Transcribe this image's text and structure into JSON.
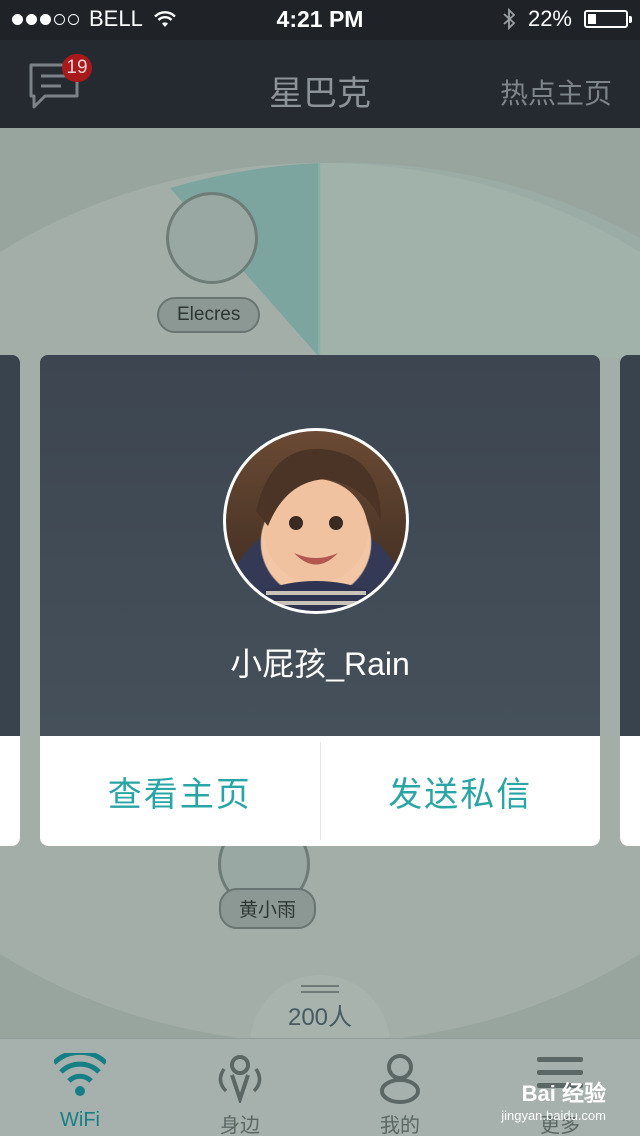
{
  "status_bar": {
    "carrier": "BELL",
    "time": "4:21 PM",
    "battery": "22%",
    "battery_level": 0.22,
    "signal_bars": 3
  },
  "nav": {
    "title": "星巴克",
    "right_link": "热点主页",
    "message_badge": "19"
  },
  "peers": [
    {
      "name": "Elecres"
    },
    {
      "name": "黄小雨"
    }
  ],
  "card": {
    "user_name": "小屁孩_Rain",
    "view_profile": "查看主页",
    "send_message": "发送私信"
  },
  "people_count": "200人",
  "tabs": [
    {
      "label": "WiFi",
      "icon": "wifi-icon",
      "active": true
    },
    {
      "label": "身边",
      "icon": "nearby-icon",
      "active": false
    },
    {
      "label": "我的",
      "icon": "person-icon",
      "active": false
    },
    {
      "label": "更多",
      "icon": "menu-icon",
      "active": false
    }
  ],
  "watermark": {
    "logo": "Bai 经验",
    "url": "jingyan.baidu.com"
  },
  "colors": {
    "accent": "#2aa5a5",
    "badge": "#a8191b",
    "nav_bg": "#242a2f"
  }
}
